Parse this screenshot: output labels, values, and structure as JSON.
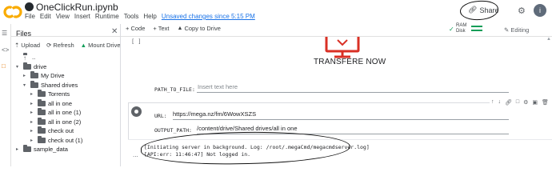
{
  "header": {
    "notebook_title": "OneClickRun.ipynb",
    "menu": [
      "File",
      "Edit",
      "View",
      "Insert",
      "Runtime",
      "Tools",
      "Help"
    ],
    "unsaved": "Unsaved changes since 5:15 PM",
    "share_label": "Share",
    "avatar_initial": "i"
  },
  "toolbar": {
    "add_code": "+ Code",
    "add_text": "+ Text",
    "copy_to_drive": "Copy to Drive",
    "ram_label": "RAM",
    "disk_label": "Disk",
    "editing_label": "Editing"
  },
  "files_panel": {
    "title": "Files",
    "upload": "Upload",
    "refresh": "Refresh",
    "mount": "Mount Drive",
    "items": [
      {
        "label": "..",
        "depth": 0,
        "caret": "",
        "kind": "up"
      },
      {
        "label": "drive",
        "depth": 0,
        "caret": "▾",
        "kind": "folder"
      },
      {
        "label": "My Drive",
        "depth": 1,
        "caret": "▸",
        "kind": "folder"
      },
      {
        "label": "Shared drives",
        "depth": 1,
        "caret": "▾",
        "kind": "folder"
      },
      {
        "label": "Torrents",
        "depth": 2,
        "caret": "▸",
        "kind": "folder"
      },
      {
        "label": "all in one",
        "depth": 2,
        "caret": "▸",
        "kind": "folder"
      },
      {
        "label": "all in one (1)",
        "depth": 2,
        "caret": "▸",
        "kind": "folder"
      },
      {
        "label": "all in one (2)",
        "depth": 2,
        "caret": "▸",
        "kind": "folder"
      },
      {
        "label": "check out",
        "depth": 2,
        "caret": "▸",
        "kind": "folder"
      },
      {
        "label": "check out (1)",
        "depth": 2,
        "caret": "▸",
        "kind": "folder"
      },
      {
        "label": "sample_data",
        "depth": 0,
        "caret": "▸",
        "kind": "folder"
      }
    ]
  },
  "cell1": {
    "bracket": "[ ]",
    "heading": "TRANSFERE NOW",
    "path_label": "PATH_TO_FILE:",
    "path_placeholder": "Insert text here"
  },
  "cell2": {
    "url_label": "URL:",
    "url_value": "https://mega.nz/fm/6WowXSZS",
    "output_label": "OUTPUT_PATH:",
    "output_value": "/content/drive/Shared drives/all in one",
    "output_dots": "...",
    "output_lines": [
      "[Initiating server in background. Log: /root/.megaCmd/megacmdserver.log]",
      "[API:err: 11:46:47] Not logged in."
    ]
  },
  "colors": {
    "accent": "#1a73e8",
    "brand_orange": "#f9ab00",
    "monitor_red": "#d93025",
    "ram_green": "#0f9d58"
  }
}
